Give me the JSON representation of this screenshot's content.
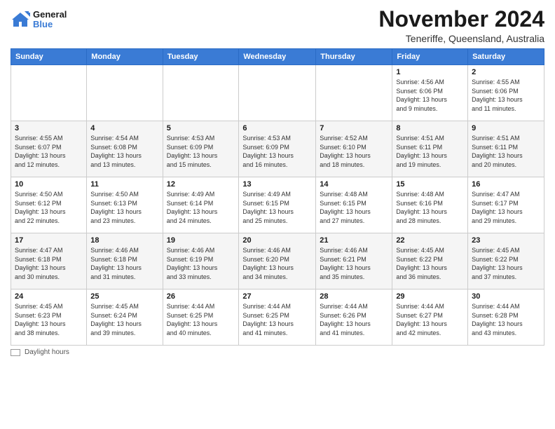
{
  "header": {
    "logo_line1": "General",
    "logo_line2": "Blue",
    "title": "November 2024",
    "subtitle": "Teneriffe, Queensland, Australia"
  },
  "calendar": {
    "days_of_week": [
      "Sunday",
      "Monday",
      "Tuesday",
      "Wednesday",
      "Thursday",
      "Friday",
      "Saturday"
    ],
    "weeks": [
      [
        {
          "day": "",
          "info": ""
        },
        {
          "day": "",
          "info": ""
        },
        {
          "day": "",
          "info": ""
        },
        {
          "day": "",
          "info": ""
        },
        {
          "day": "",
          "info": ""
        },
        {
          "day": "1",
          "info": "Sunrise: 4:56 AM\nSunset: 6:06 PM\nDaylight: 13 hours\nand 9 minutes."
        },
        {
          "day": "2",
          "info": "Sunrise: 4:55 AM\nSunset: 6:06 PM\nDaylight: 13 hours\nand 11 minutes."
        }
      ],
      [
        {
          "day": "3",
          "info": "Sunrise: 4:55 AM\nSunset: 6:07 PM\nDaylight: 13 hours\nand 12 minutes."
        },
        {
          "day": "4",
          "info": "Sunrise: 4:54 AM\nSunset: 6:08 PM\nDaylight: 13 hours\nand 13 minutes."
        },
        {
          "day": "5",
          "info": "Sunrise: 4:53 AM\nSunset: 6:09 PM\nDaylight: 13 hours\nand 15 minutes."
        },
        {
          "day": "6",
          "info": "Sunrise: 4:53 AM\nSunset: 6:09 PM\nDaylight: 13 hours\nand 16 minutes."
        },
        {
          "day": "7",
          "info": "Sunrise: 4:52 AM\nSunset: 6:10 PM\nDaylight: 13 hours\nand 18 minutes."
        },
        {
          "day": "8",
          "info": "Sunrise: 4:51 AM\nSunset: 6:11 PM\nDaylight: 13 hours\nand 19 minutes."
        },
        {
          "day": "9",
          "info": "Sunrise: 4:51 AM\nSunset: 6:11 PM\nDaylight: 13 hours\nand 20 minutes."
        }
      ],
      [
        {
          "day": "10",
          "info": "Sunrise: 4:50 AM\nSunset: 6:12 PM\nDaylight: 13 hours\nand 22 minutes."
        },
        {
          "day": "11",
          "info": "Sunrise: 4:50 AM\nSunset: 6:13 PM\nDaylight: 13 hours\nand 23 minutes."
        },
        {
          "day": "12",
          "info": "Sunrise: 4:49 AM\nSunset: 6:14 PM\nDaylight: 13 hours\nand 24 minutes."
        },
        {
          "day": "13",
          "info": "Sunrise: 4:49 AM\nSunset: 6:15 PM\nDaylight: 13 hours\nand 25 minutes."
        },
        {
          "day": "14",
          "info": "Sunrise: 4:48 AM\nSunset: 6:15 PM\nDaylight: 13 hours\nand 27 minutes."
        },
        {
          "day": "15",
          "info": "Sunrise: 4:48 AM\nSunset: 6:16 PM\nDaylight: 13 hours\nand 28 minutes."
        },
        {
          "day": "16",
          "info": "Sunrise: 4:47 AM\nSunset: 6:17 PM\nDaylight: 13 hours\nand 29 minutes."
        }
      ],
      [
        {
          "day": "17",
          "info": "Sunrise: 4:47 AM\nSunset: 6:18 PM\nDaylight: 13 hours\nand 30 minutes."
        },
        {
          "day": "18",
          "info": "Sunrise: 4:46 AM\nSunset: 6:18 PM\nDaylight: 13 hours\nand 31 minutes."
        },
        {
          "day": "19",
          "info": "Sunrise: 4:46 AM\nSunset: 6:19 PM\nDaylight: 13 hours\nand 33 minutes."
        },
        {
          "day": "20",
          "info": "Sunrise: 4:46 AM\nSunset: 6:20 PM\nDaylight: 13 hours\nand 34 minutes."
        },
        {
          "day": "21",
          "info": "Sunrise: 4:46 AM\nSunset: 6:21 PM\nDaylight: 13 hours\nand 35 minutes."
        },
        {
          "day": "22",
          "info": "Sunrise: 4:45 AM\nSunset: 6:22 PM\nDaylight: 13 hours\nand 36 minutes."
        },
        {
          "day": "23",
          "info": "Sunrise: 4:45 AM\nSunset: 6:22 PM\nDaylight: 13 hours\nand 37 minutes."
        }
      ],
      [
        {
          "day": "24",
          "info": "Sunrise: 4:45 AM\nSunset: 6:23 PM\nDaylight: 13 hours\nand 38 minutes."
        },
        {
          "day": "25",
          "info": "Sunrise: 4:45 AM\nSunset: 6:24 PM\nDaylight: 13 hours\nand 39 minutes."
        },
        {
          "day": "26",
          "info": "Sunrise: 4:44 AM\nSunset: 6:25 PM\nDaylight: 13 hours\nand 40 minutes."
        },
        {
          "day": "27",
          "info": "Sunrise: 4:44 AM\nSunset: 6:25 PM\nDaylight: 13 hours\nand 41 minutes."
        },
        {
          "day": "28",
          "info": "Sunrise: 4:44 AM\nSunset: 6:26 PM\nDaylight: 13 hours\nand 41 minutes."
        },
        {
          "day": "29",
          "info": "Sunrise: 4:44 AM\nSunset: 6:27 PM\nDaylight: 13 hours\nand 42 minutes."
        },
        {
          "day": "30",
          "info": "Sunrise: 4:44 AM\nSunset: 6:28 PM\nDaylight: 13 hours\nand 43 minutes."
        }
      ]
    ]
  },
  "footer": {
    "label": "Daylight hours"
  }
}
